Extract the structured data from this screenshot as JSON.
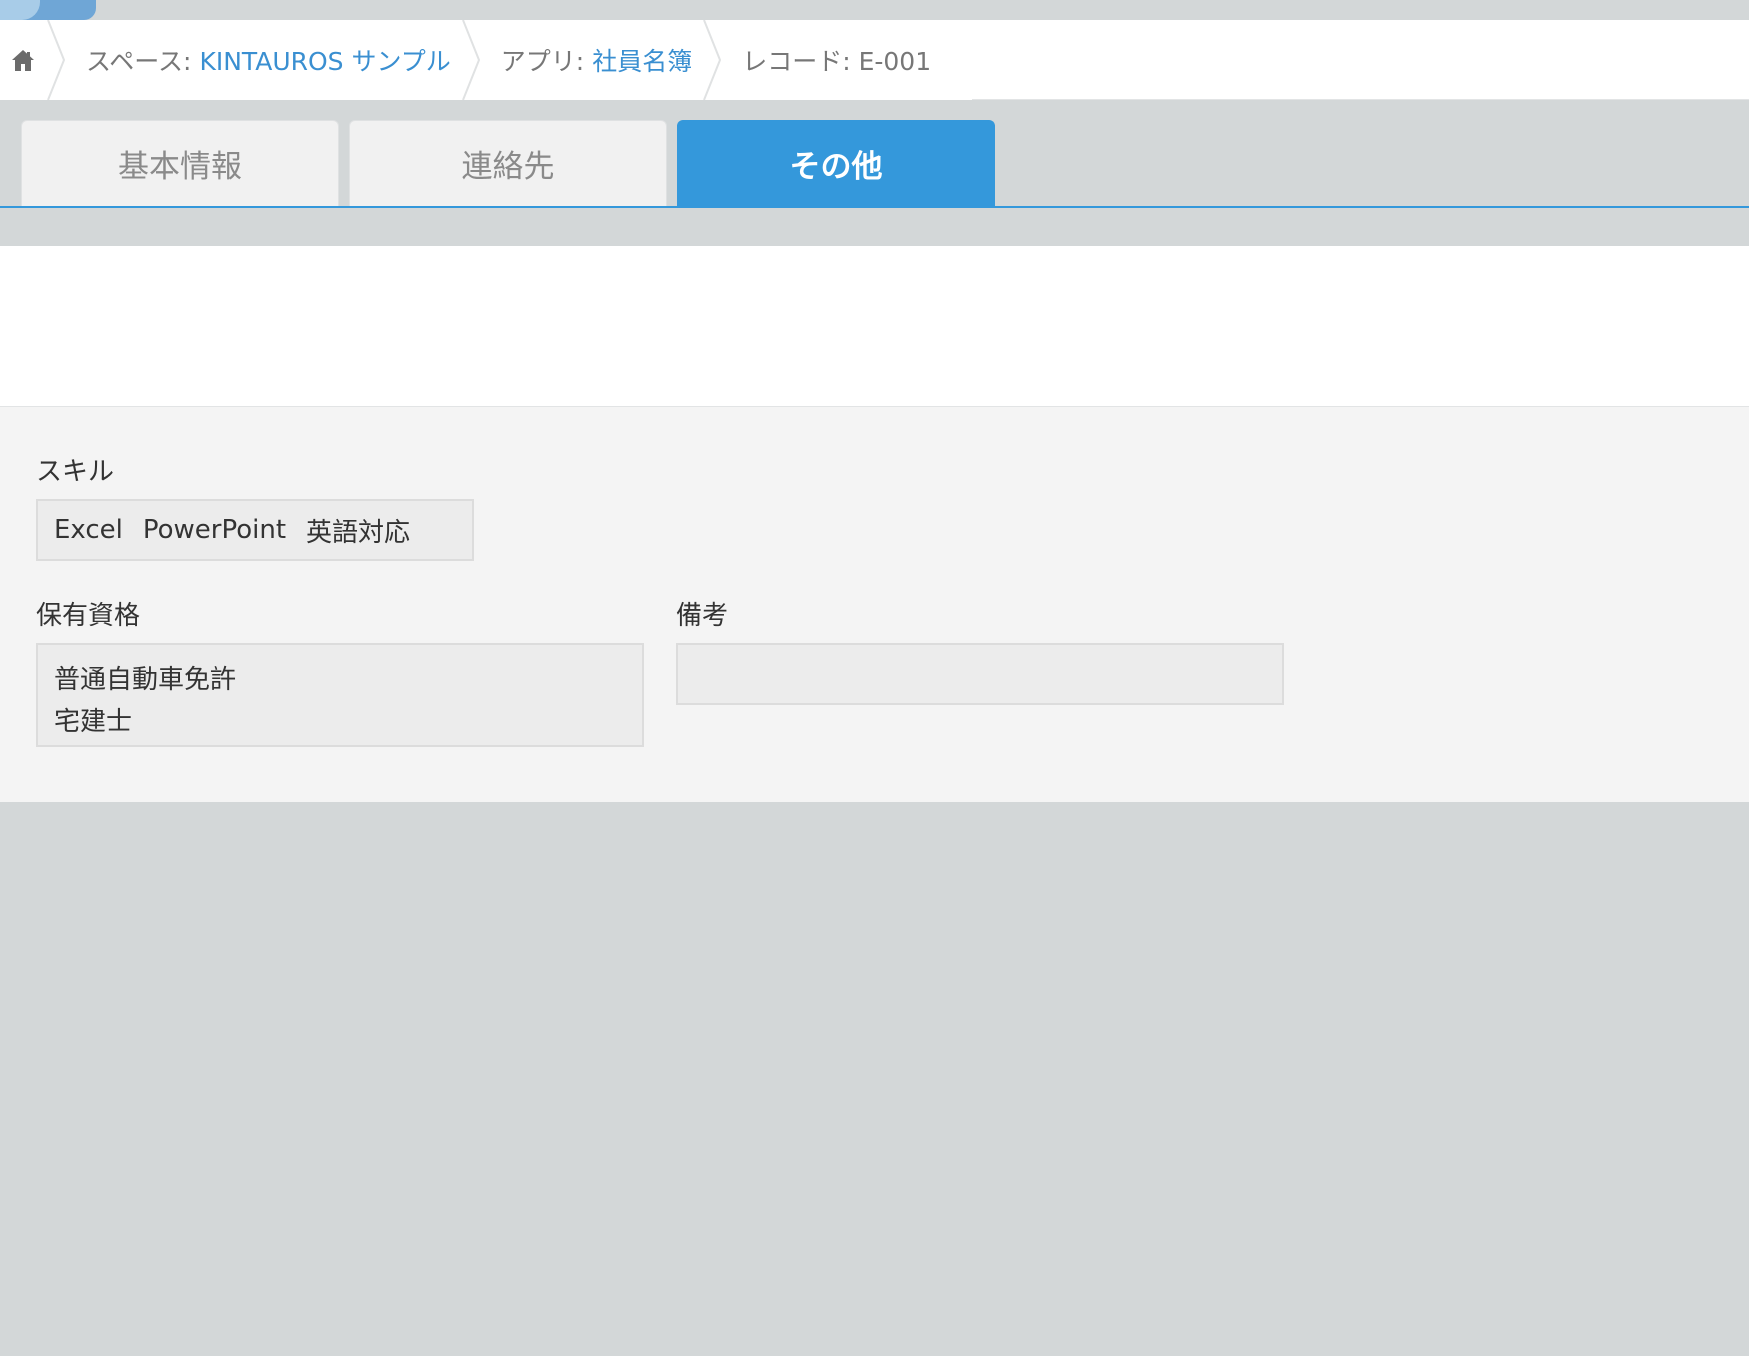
{
  "breadcrumb": {
    "home_icon": "home-icon",
    "space_prefix": "スペース:",
    "space_name": "KINTAUROS サンプル",
    "app_prefix": "アプリ:",
    "app_name": "社員名簿",
    "record_label": "レコード: E-001"
  },
  "tabs": [
    {
      "label": "基本情報",
      "active": false
    },
    {
      "label": "連絡先",
      "active": false
    },
    {
      "label": "その他",
      "active": true
    }
  ],
  "fields": {
    "skills": {
      "label": "スキル",
      "values": [
        "Excel",
        "PowerPoint",
        "英語対応"
      ]
    },
    "qualifications": {
      "label": "保有資格",
      "lines": [
        "普通自動車免許",
        "宅建士"
      ]
    },
    "notes": {
      "label": "備考",
      "value": ""
    }
  },
  "colors": {
    "accent": "#3498db",
    "link": "#3a8fd1",
    "background": "#d3d7d8"
  }
}
